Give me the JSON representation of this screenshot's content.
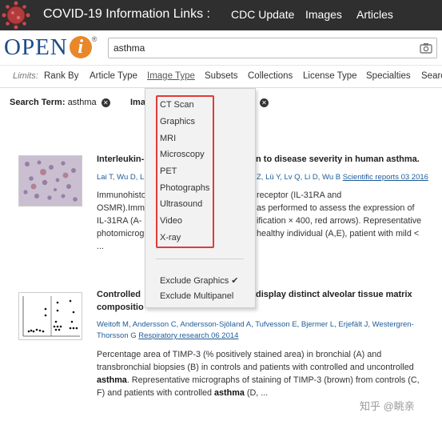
{
  "covid": {
    "title": "COVID-19 Information Links :",
    "links": [
      "CDC Update",
      "Images",
      "Articles"
    ]
  },
  "logo": {
    "text": "OPEN",
    "i_letter": "i",
    "reg": "®"
  },
  "search": {
    "value": "asthma",
    "placeholder": ""
  },
  "limits": {
    "label": "Limits:",
    "items": [
      "Rank By",
      "Article Type",
      "Image Type",
      "Subsets",
      "Collections",
      "License Type",
      "Specialties",
      "Searc"
    ]
  },
  "search_term": {
    "label": "Search Term:",
    "value": "asthma",
    "second_label": "Ima"
  },
  "dropdown": {
    "items": [
      "CT Scan",
      "Graphics",
      "MRI",
      "Microscopy",
      "PET",
      "Photographs",
      "Ultrasound",
      "Video",
      "X-ray"
    ],
    "exclude_graphics": "Exclude Graphics",
    "exclude_graphics_check": "✔",
    "exclude_multipanel": "Exclude Multipanel"
  },
  "results": [
    {
      "title_left": "Interleukin-",
      "title_right": "n to disease severity in human asthma.",
      "authors_left": "Lai T, Wu D, L",
      "authors_right": "Z, Lü Y, Lv Q, Li D, Wu B",
      "journal": "Scientific reports 03 2016",
      "snippet_lines_left": [
        "Immunohisto",
        "OSMR).Imm",
        "IL-31RA (A-",
        "photomicrog",
        "..."
      ],
      "snippet_lines_right": [
        "receptor (IL-31RA and",
        "as performed to assess the expression of",
        "ification × 400, red arrows). Representative",
        "healthy individual (A,E), patient with mild <"
      ]
    },
    {
      "title_left": "Controlled",
      "title_right": "display distinct alveolar tissue matrix",
      "title2_left": "compositio",
      "authors_line1": "Weitoft M, Andersson C, Andersson-Sjöland A, Tufvesson E, Bjermer L, Erjefält J, Westergren-",
      "authors_line2_prefix": "Thorsson G",
      "journal": "Respiratory research 06 2014",
      "snippet_line1": "Percentage area of TIMP-3 (% positively stained area) in bronchial (A) and",
      "snippet_line2": "transbronchial biopsies (B) in controls and patients with controlled and uncontrolled",
      "snippet_line3_bold": "asthma",
      "snippet_line3_rest": ". Representative micrographs of staining of TIMP-3 (brown) from controls (C,",
      "snippet_line4_prefix": "F) and patients with controlled ",
      "snippet_line4_bold": "asthma",
      "snippet_line4_rest": " (D, ..."
    }
  ],
  "watermark": "知乎 @眺亲",
  "colors": {
    "covid_bar": "#2f2f2f",
    "logo_blue": "#1e4c8a",
    "logo_orange": "#e8882a",
    "link_blue": "#1d5b99",
    "highlight_red": "#e03a3a"
  }
}
